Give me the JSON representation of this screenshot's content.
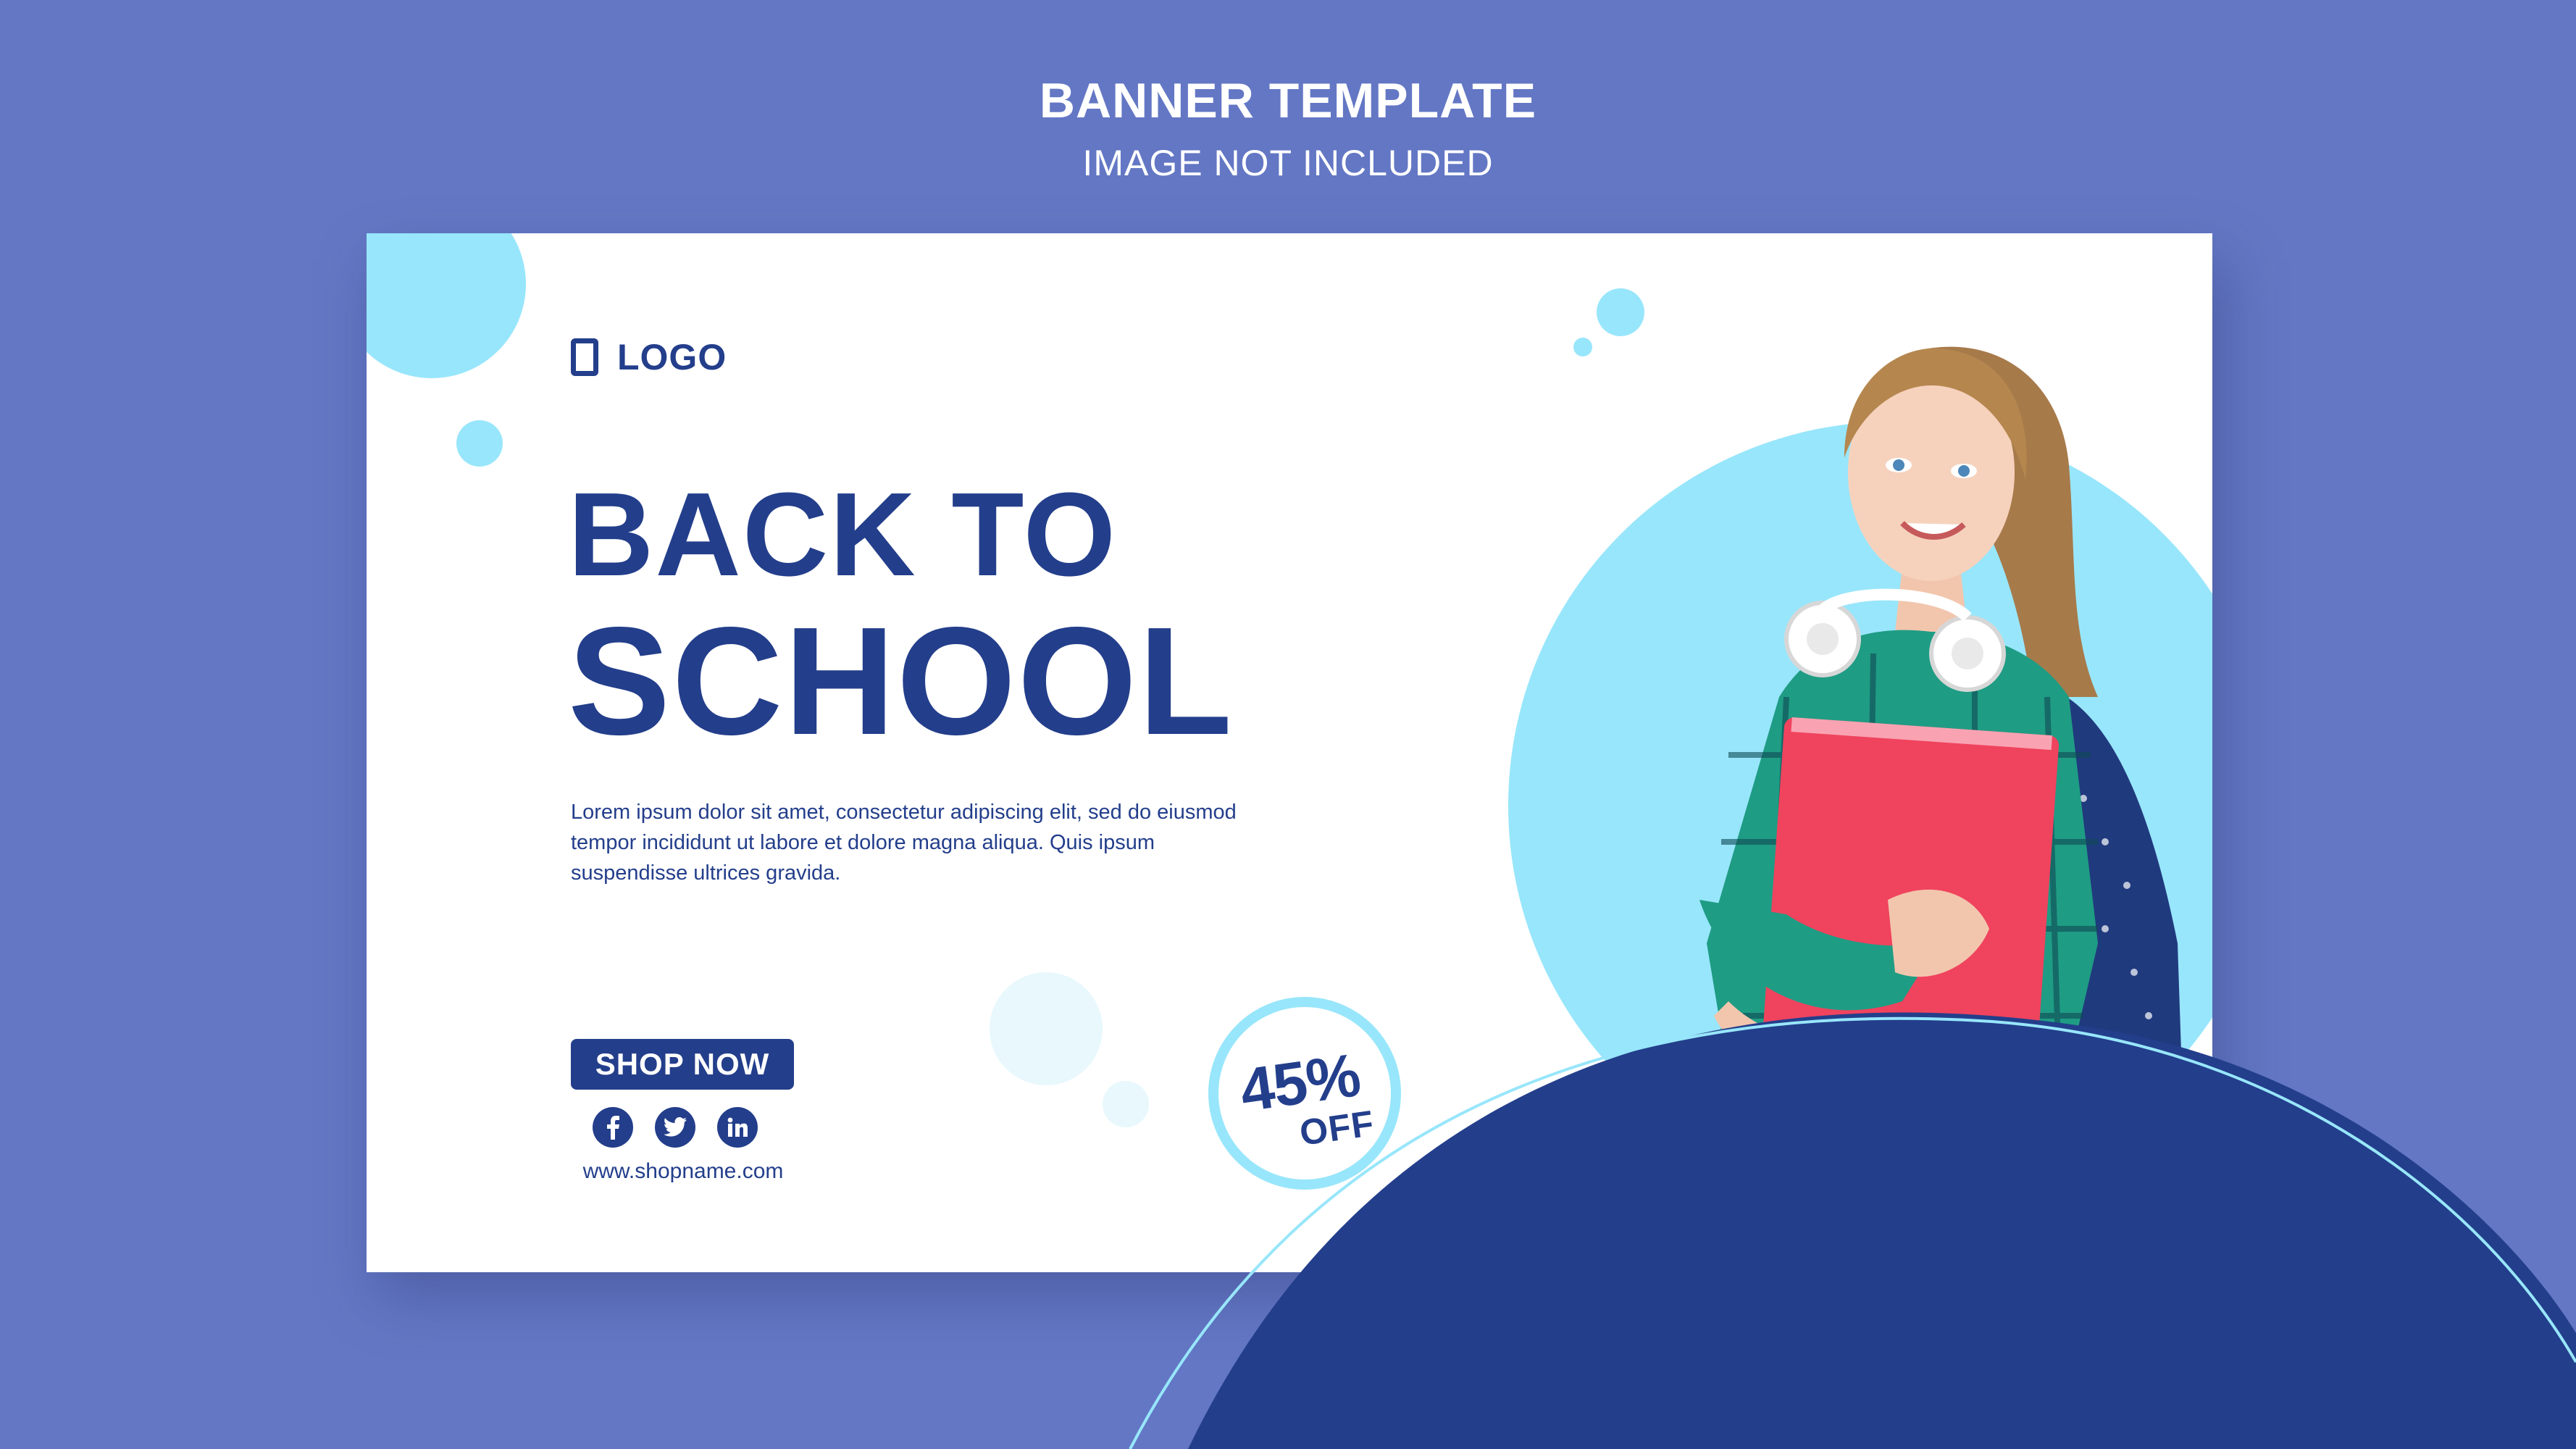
{
  "header": {
    "title": "BANNER TEMPLATE",
    "subtitle": "IMAGE NOT INCLUDED"
  },
  "banner": {
    "logo_text": "LOGO",
    "headline_line1": "BACK TO",
    "headline_line2": "SCHOOL",
    "body_text": "Lorem ipsum dolor sit amet, consectetur adipiscing elit, sed do eiusmod tempor incididunt ut labore et dolore magna aliqua. Quis ipsum suspendisse ultrices gravida.",
    "cta_label": "SHOP NOW",
    "website": "www.shopname.com",
    "discount_value": "45%",
    "discount_label": "OFF",
    "social_icons": [
      "facebook-icon",
      "twitter-icon",
      "linkedin-icon"
    ]
  },
  "colors": {
    "background": "#6377c4",
    "navy": "#233e8b",
    "light_blue": "#98e6fb",
    "white": "#ffffff",
    "folder_red": "#f0435e",
    "shirt_green": "#1f9c84"
  }
}
